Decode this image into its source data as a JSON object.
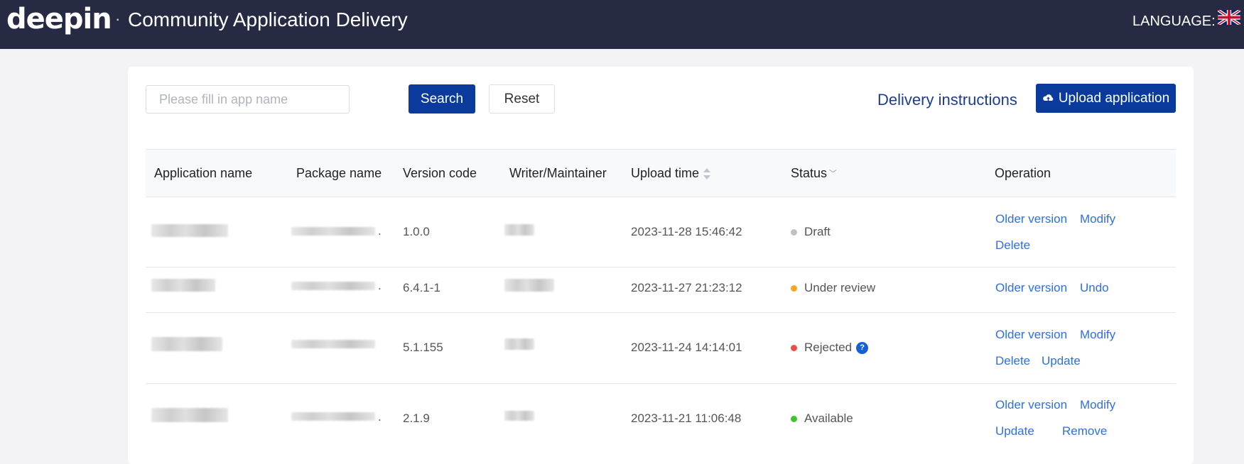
{
  "header": {
    "logo": "deepin",
    "separator": "·",
    "title": "Community Application Delivery",
    "language_label": "LANGUAGE:",
    "language_flag": "uk-flag"
  },
  "toolbar": {
    "search_placeholder": "Please fill in app name",
    "search_value": "",
    "search_label": "Search",
    "reset_label": "Reset",
    "delivery_instructions": "Delivery instructions",
    "upload_label": "Upload application"
  },
  "table": {
    "columns": [
      "Application name",
      "Package name",
      "Version code",
      "Writer/Maintainer",
      "Upload time",
      "Status",
      "Operation"
    ],
    "rows": [
      {
        "version": "1.0.0",
        "upload_time": "2023-11-28 15:46:42",
        "status": "Draft",
        "status_color": "#c0c0c0",
        "ops": [
          "Older version",
          "Modify",
          "Delete"
        ]
      },
      {
        "version": "6.4.1-1",
        "upload_time": "2023-11-27 21:23:12",
        "status": "Under review",
        "status_color": "#f5a623",
        "ops": [
          "Older version",
          "Undo"
        ]
      },
      {
        "version": "5.1.155",
        "upload_time": "2023-11-24 14:14:01",
        "status": "Rejected",
        "status_color": "#f04a4a",
        "help": "?",
        "ops": [
          "Older version",
          "Modify",
          "Delete",
          "Update"
        ]
      },
      {
        "version": "2.1.9",
        "upload_time": "2023-11-21 11:06:48",
        "status": "Available",
        "status_color": "#3fc42b",
        "ops": [
          "Older version",
          "Modify",
          "Update",
          "Remove"
        ]
      }
    ]
  },
  "colors": {
    "header_bg": "#262a43",
    "primary": "#0a3a9c",
    "link": "#2f6fe0"
  }
}
